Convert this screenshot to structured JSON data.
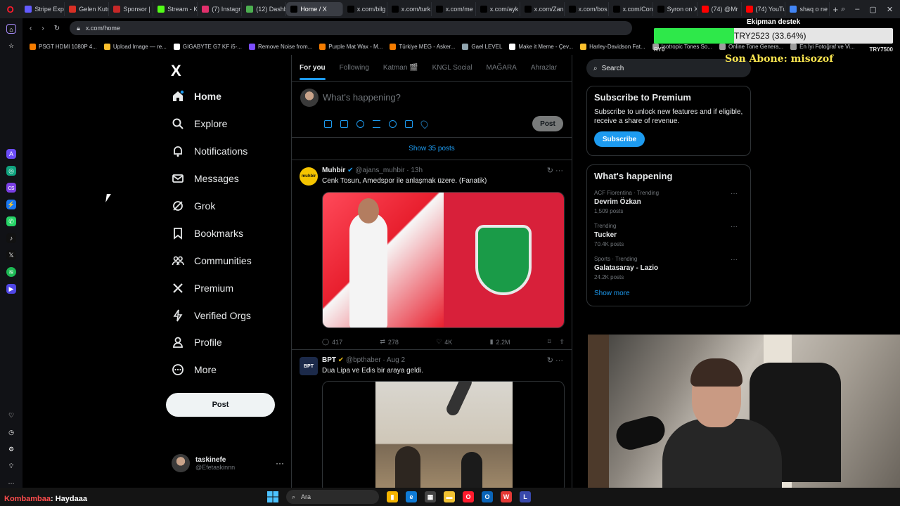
{
  "browser": {
    "tabs": [
      {
        "label": "Stripe Expr",
        "color": "#635bff",
        "active": false
      },
      {
        "label": "Gelen Kutu",
        "color": "#d93025",
        "active": false
      },
      {
        "label": "Sponsor |",
        "color": "#c62828",
        "active": false
      },
      {
        "label": "Stream - K",
        "color": "#53fc18",
        "active": false
      },
      {
        "label": "(7) Instagr",
        "color": "#e1306c",
        "active": false
      },
      {
        "label": "(12) Dashb",
        "color": "#4caf50",
        "active": false
      },
      {
        "label": "Home / X",
        "color": "#000000",
        "active": true
      },
      {
        "label": "x.com/bilg",
        "color": "#000000",
        "active": false
      },
      {
        "label": "x.com/turk",
        "color": "#000000",
        "active": false
      },
      {
        "label": "x.com/me",
        "color": "#000000",
        "active": false
      },
      {
        "label": "x.com/ayk",
        "color": "#000000",
        "active": false
      },
      {
        "label": "x.com/Zan",
        "color": "#000000",
        "active": false
      },
      {
        "label": "x.com/bos",
        "color": "#000000",
        "active": false
      },
      {
        "label": "x.com/Con",
        "color": "#000000",
        "active": false
      },
      {
        "label": "Syron on X",
        "color": "#000000",
        "active": false
      },
      {
        "label": "(74) @Mr",
        "color": "#ff0000",
        "active": false
      },
      {
        "label": "(74) YouTu",
        "color": "#ff0000",
        "active": false
      },
      {
        "label": "shaq o ne",
        "color": "#4285f4",
        "active": false
      }
    ],
    "url": "x.com/home",
    "bookmarks": [
      {
        "label": "PSGT HDMI 1080P 4...",
        "color": "#f57c00"
      },
      {
        "label": "Upload Image — re...",
        "color": "#fbc02d"
      },
      {
        "label": "GIGABYTE G7 KF i5-...",
        "color": "#ffffff"
      },
      {
        "label": "Remove Noise from...",
        "color": "#7c4dff"
      },
      {
        "label": "Purple Mat Wax - M...",
        "color": "#f57c00"
      },
      {
        "label": "Türkiye MEG - Asker...",
        "color": "#f57c00"
      },
      {
        "label": "Gael LEVEL",
        "color": "#90a4ae"
      },
      {
        "label": "Make it Meme - Çev...",
        "color": "#ffffff"
      },
      {
        "label": "Harley-Davidson Fat...",
        "color": "#fbc02d"
      },
      {
        "label": "Isotropic Tones So...",
        "color": "#9e9e9e"
      },
      {
        "label": "Online Tone Genera...",
        "color": "#9e9e9e"
      },
      {
        "label": "En İyi Fotoğraf ve Vi...",
        "color": "#9e9e9e"
      }
    ]
  },
  "x": {
    "logo": "X",
    "nav": [
      {
        "label": "Home",
        "name": "home",
        "icon": "home-icon"
      },
      {
        "label": "Explore",
        "name": "explore",
        "icon": "search-icon"
      },
      {
        "label": "Notifications",
        "name": "notifications",
        "icon": "bell-icon"
      },
      {
        "label": "Messages",
        "name": "messages",
        "icon": "mail-icon"
      },
      {
        "label": "Grok",
        "name": "grok",
        "icon": "grok-icon"
      },
      {
        "label": "Bookmarks",
        "name": "bookmarks",
        "icon": "bookmark-icon"
      },
      {
        "label": "Communities",
        "name": "communities",
        "icon": "people-icon"
      },
      {
        "label": "Premium",
        "name": "premium",
        "icon": "x-icon"
      },
      {
        "label": "Verified Orgs",
        "name": "verified-orgs",
        "icon": "lightning-icon"
      },
      {
        "label": "Profile",
        "name": "profile",
        "icon": "person-icon"
      },
      {
        "label": "More",
        "name": "more",
        "icon": "more-circle-icon"
      }
    ],
    "post_button": "Post",
    "user": {
      "name": "taskinefe",
      "handle": "@Efetaskinnn"
    },
    "timeline_tabs": [
      "For you",
      "Following",
      "Katman 🎬",
      "KNGL Social",
      "MAĞARA",
      "Ahrazlar"
    ],
    "composer": {
      "placeholder": "What's happening?",
      "post": "Post"
    },
    "show_posts": "Show 35 posts",
    "tweets": [
      {
        "name": "Muhbir",
        "handle": "@ajans_muhbir",
        "time": "· 13h",
        "text": "Cenk Tosun, Amedspor ile anlaşmak üzere. (Fanatik)",
        "avatar_text": "muhbir",
        "avatar_color": "#f5c400",
        "stats": {
          "replies": "417",
          "reposts": "278",
          "likes": "4K",
          "views": "2.2M"
        }
      },
      {
        "name": "BPT",
        "handle": "@bpthaber",
        "time": "· Aug 2",
        "text": "Dua Lipa ve Edis bir araya geldi.",
        "avatar_text": "BPT",
        "avatar_color": "#1c2a4a"
      }
    ],
    "sidebar": {
      "search_placeholder": "Search",
      "premium": {
        "title": "Subscribe to Premium",
        "body": "Subscribe to unlock new features and if eligible, receive a share of revenue.",
        "button": "Subscribe"
      },
      "happening": {
        "title": "What's happening",
        "trends": [
          {
            "context": "ACF Fiorentina · Trending",
            "name": "Devrim Özkan",
            "posts": "1,509 posts"
          },
          {
            "context": "Trending",
            "name": "Tucker",
            "posts": "70.4K posts"
          },
          {
            "context": "Sports · Trending",
            "name": "Galatasaray - Lazio",
            "posts": "24.2K posts"
          }
        ],
        "show_more": "Show more"
      }
    }
  },
  "overlay": {
    "donation_label": "Ekipman destek",
    "donation_value": "TRY2523 (33.64%)",
    "donation_progress": 33.64,
    "min": "RY0",
    "max": "TRY7500",
    "last_sub": "Son Abone: misozof",
    "chat_user": "Kombambaa",
    "chat_message": ": Haydaaa"
  },
  "taskbar": {
    "search": "Ara",
    "apps": [
      {
        "name": "files",
        "color": "#f4b400",
        "glyph": "▮"
      },
      {
        "name": "edge",
        "color": "#0f7bd6",
        "glyph": "e"
      },
      {
        "name": "store",
        "color": "#444444",
        "glyph": "▦"
      },
      {
        "name": "explorer",
        "color": "#f1c232",
        "glyph": "▬"
      },
      {
        "name": "opera",
        "color": "#ff1b2d",
        "glyph": "O"
      },
      {
        "name": "outlook",
        "color": "#0a64b8",
        "glyph": "O"
      },
      {
        "name": "wps",
        "color": "#e53935",
        "glyph": "W"
      },
      {
        "name": "launcher",
        "color": "#3949ab",
        "glyph": "L"
      }
    ]
  }
}
